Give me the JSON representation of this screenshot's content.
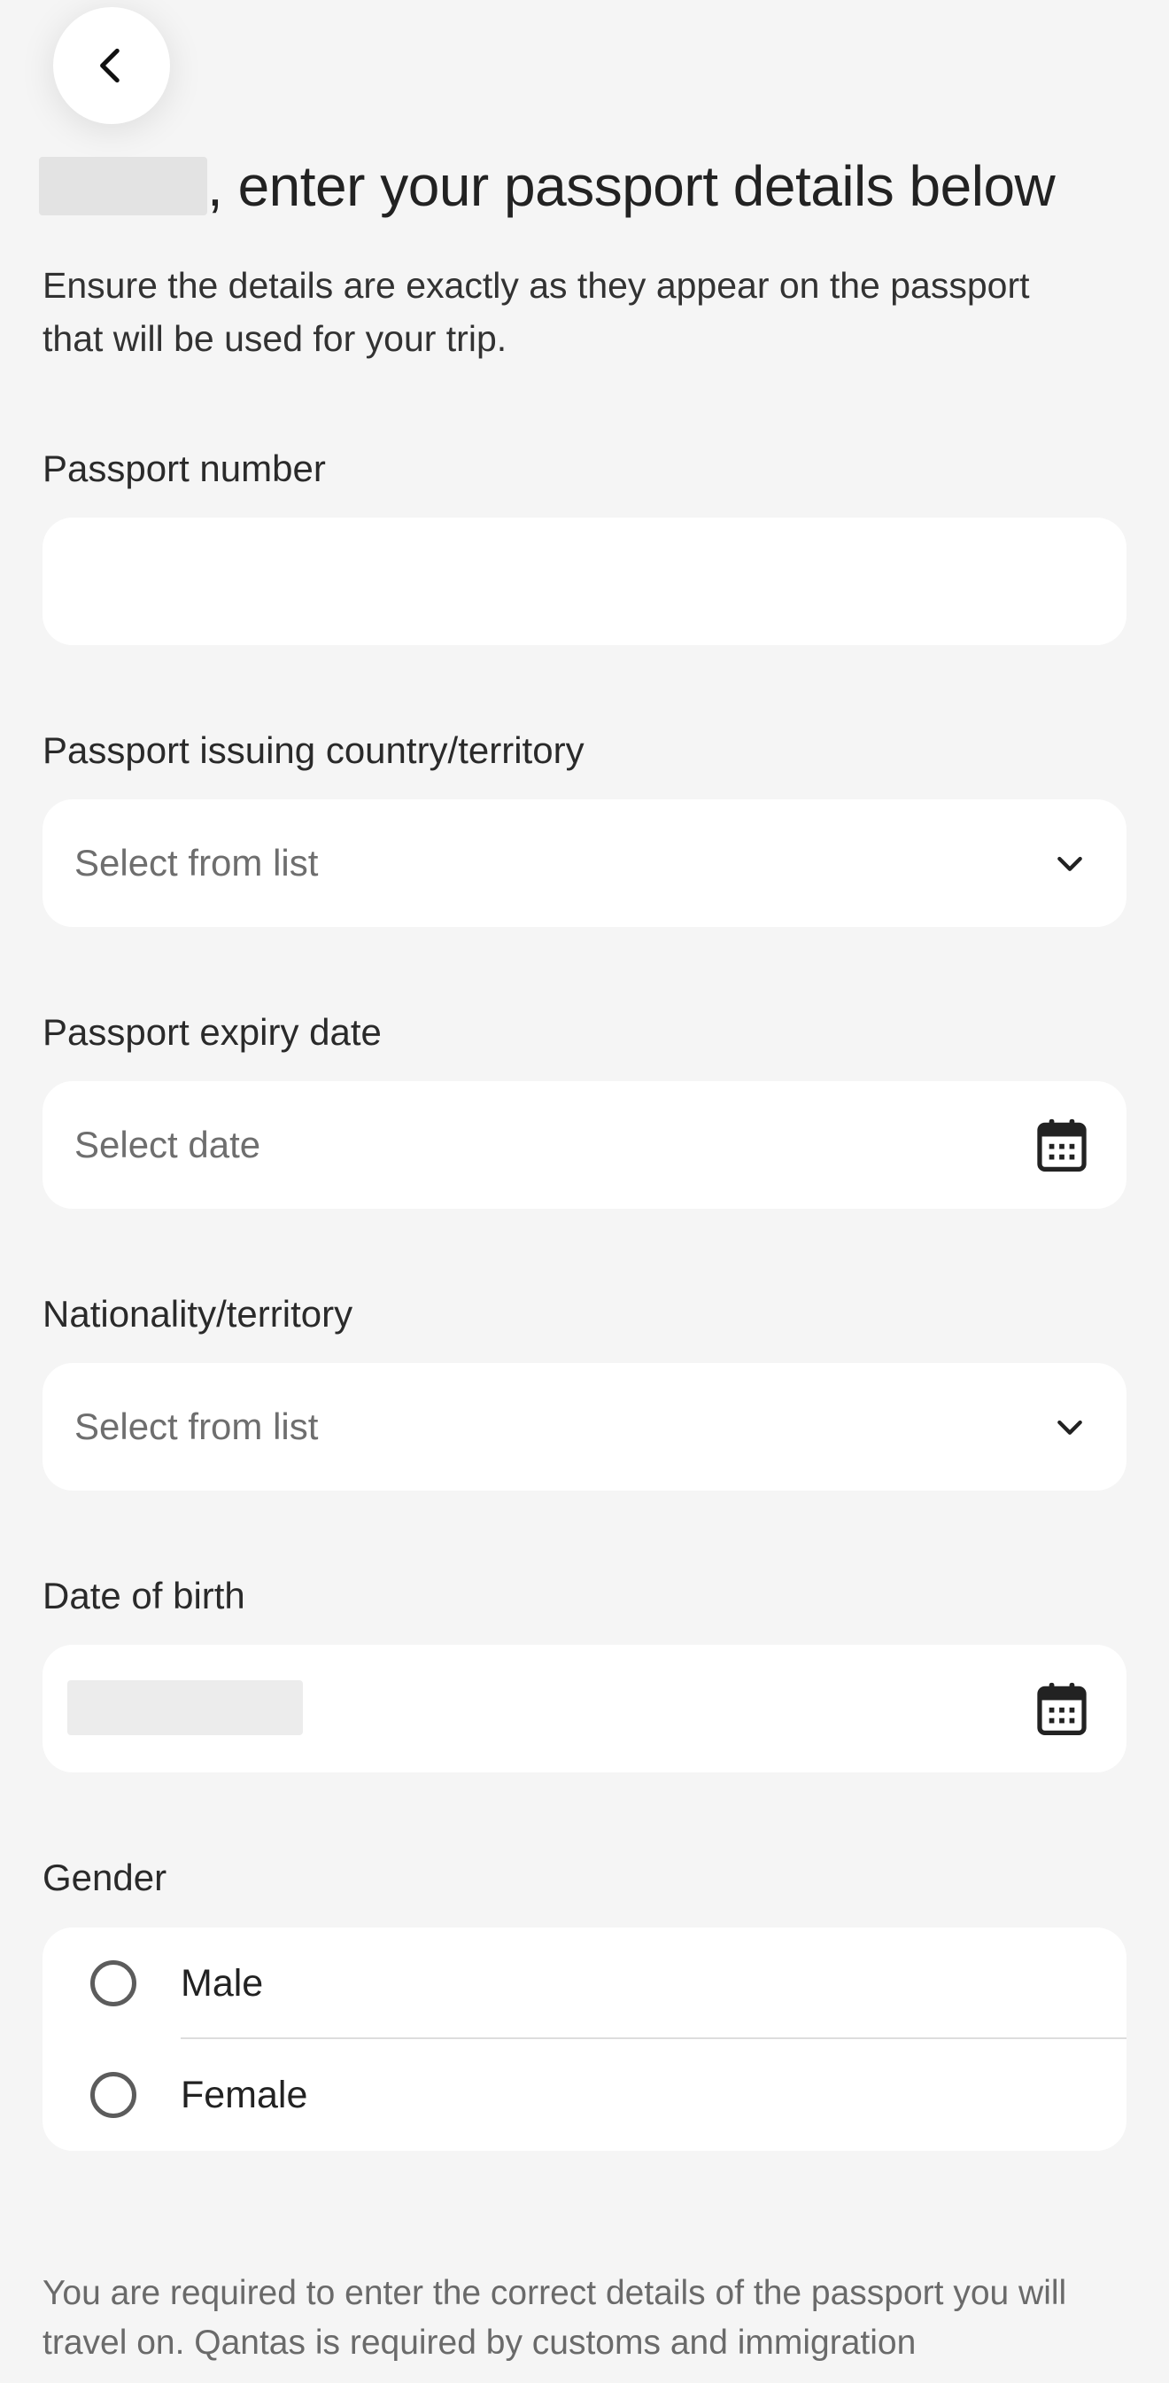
{
  "header": {
    "back_icon": "chevron-left-icon",
    "title_suffix": ", enter your passport details below",
    "subtitle": "Ensure the details are exactly as they appear on the passport that will be used for your trip."
  },
  "form": {
    "passport_number": {
      "label": "Passport number",
      "value": ""
    },
    "issuing_country": {
      "label": "Passport issuing country/territory",
      "placeholder": "Select from list",
      "icon": "chevron-down-icon"
    },
    "expiry_date": {
      "label": "Passport expiry date",
      "placeholder": "Select date",
      "icon": "calendar-icon"
    },
    "nationality": {
      "label": "Nationality/territory",
      "placeholder": "Select from list",
      "icon": "chevron-down-icon"
    },
    "date_of_birth": {
      "label": "Date of birth",
      "icon": "calendar-icon"
    },
    "gender": {
      "label": "Gender",
      "options": [
        "Male",
        "Female"
      ]
    }
  },
  "footer": {
    "note": "You are required to enter the correct details of the passport you will travel on. Qantas is required by customs and immigration"
  }
}
